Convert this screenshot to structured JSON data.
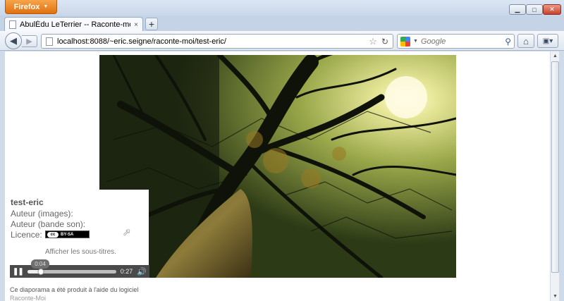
{
  "window": {
    "app_menu_label": "Firefox",
    "minimize_glyph": "▁",
    "maximize_glyph": "□",
    "close_glyph": "✕"
  },
  "tabs": [
    {
      "title": "AbulÉdu LeTerrier -- Raconte-moi test-e...",
      "close_glyph": "×"
    }
  ],
  "new_tab_glyph": "+",
  "navbar": {
    "url": "localhost:8088/~eric.seigne/raconte-moi/test-eric/",
    "search_placeholder": "Google"
  },
  "icons": {
    "back": "arrow-left",
    "forward": "arrow-right",
    "bookmark": "star",
    "reload": "reload",
    "search_engine": "google-logo",
    "search": "magnifier",
    "home": "home",
    "bookmarks_menu": "bookmarks"
  },
  "slideshow": {
    "title": "test-eric",
    "author_images_label": "Auteur (images):",
    "author_sound_label": "Auteur (bande son):",
    "license_label": "Licence:",
    "license_badge": "BY-SA",
    "license_mark": "cc",
    "subtitles_link": "Afficher les sous-titres."
  },
  "player": {
    "current_time": "0:04",
    "duration": "0:27",
    "progress_fraction": 0.15,
    "pause_glyph": "❚❚",
    "volume_glyph": "🔊"
  },
  "footer": {
    "text": "Ce diaporama a été produit à l'aide du logiciel",
    "text_faded": "Raconte-Moi"
  },
  "colors": {
    "firefox_orange": "#e0700f",
    "player_bg": "#4a4a4a",
    "chrome_blue": "#cfdbe9"
  }
}
